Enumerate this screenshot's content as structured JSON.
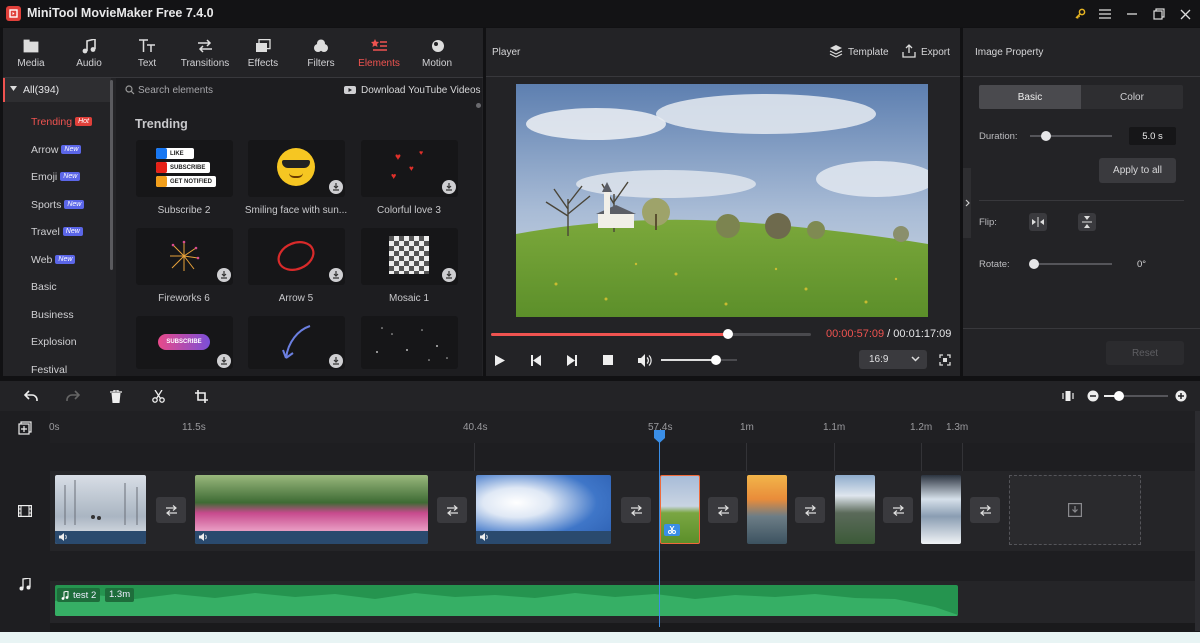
{
  "app": {
    "title": "MiniTool MovieMaker Free 7.4.0"
  },
  "tabs": [
    {
      "label": "Media",
      "icon": "media-icon"
    },
    {
      "label": "Audio",
      "icon": "music-note-icon"
    },
    {
      "label": "Text",
      "icon": "text-icon"
    },
    {
      "label": "Transitions",
      "icon": "transitions-icon"
    },
    {
      "label": "Effects",
      "icon": "effects-icon"
    },
    {
      "label": "Filters",
      "icon": "filters-icon"
    },
    {
      "label": "Elements",
      "icon": "elements-icon",
      "active": true
    },
    {
      "label": "Motion",
      "icon": "motion-icon"
    }
  ],
  "categories": {
    "all": "All(394)",
    "items": [
      {
        "label": "Trending",
        "badge": "Hot"
      },
      {
        "label": "Arrow",
        "badge": "New"
      },
      {
        "label": "Emoji",
        "badge": "New"
      },
      {
        "label": "Sports",
        "badge": "New"
      },
      {
        "label": "Travel",
        "badge": "New"
      },
      {
        "label": "Web",
        "badge": "New"
      },
      {
        "label": "Basic"
      },
      {
        "label": "Business"
      },
      {
        "label": "Explosion"
      },
      {
        "label": "Festival"
      }
    ]
  },
  "search": {
    "placeholder": "Search elements",
    "download_label": "Download YouTube Videos"
  },
  "section_title": "Trending",
  "elements": [
    "Subscribe 2",
    "Smiling face with sun...",
    "Colorful love 3",
    "Fireworks 6",
    "Arrow 5",
    "Mosaic 1"
  ],
  "subscribe_art": {
    "like": "LIKE",
    "subscribe": "SUBSCRIBE",
    "notified": "GET NOTIFIED",
    "banner": "SUBSCRIBE"
  },
  "player": {
    "title": "Player",
    "template_label": "Template",
    "export_label": "Export",
    "current_time": "00:00:57:09",
    "separator": " / ",
    "total_time": "00:01:17:09",
    "aspect": "16:9",
    "progress": 0.74,
    "volume": 0.73
  },
  "properties": {
    "title": "Image Property",
    "tab_basic": "Basic",
    "tab_color": "Color",
    "duration_label": "Duration:",
    "duration_value": "5.0 s",
    "apply_all": "Apply to all",
    "flip_label": "Flip:",
    "rotate_label": "Rotate:",
    "rotate_value": "0°",
    "reset": "Reset",
    "duration_slider": 0.15,
    "rotate_slider": 0.0
  },
  "ruler": [
    "0s",
    "11.5s",
    "40.4s",
    "57.4s",
    "1m",
    "1.1m",
    "1.2m",
    "1.3m"
  ],
  "audio_track": {
    "name": "test 2",
    "duration": "1.3m"
  },
  "colors": {
    "accent": "#ef5350",
    "panel": "#232326",
    "audio": "#27a05a",
    "playhead": "#3a8ee6"
  }
}
